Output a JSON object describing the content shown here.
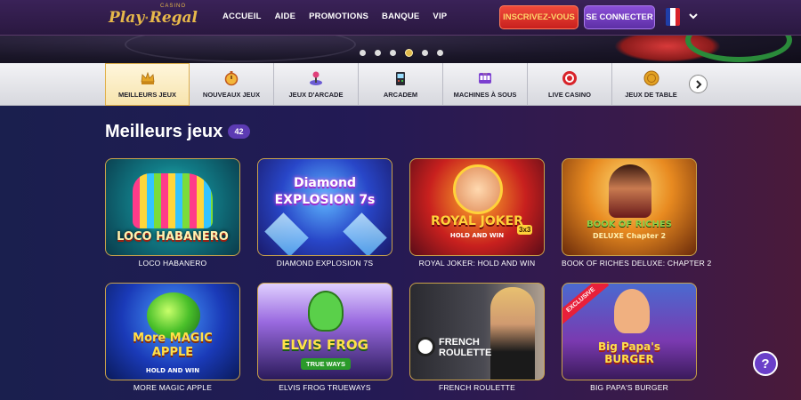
{
  "header": {
    "logo": {
      "play": "Play",
      "regal": "Regal",
      "casino": "CASINO"
    },
    "nav": [
      "ACCUEIL",
      "AIDE",
      "PROMOTIONS",
      "BANQUE",
      "VIP"
    ],
    "signup_label": "INSCRIVEZ-VOUS",
    "login_label": "SE CONNECTER",
    "language_flag": "fr-flag-icon"
  },
  "carousel": {
    "slides": 6,
    "active_index": 3
  },
  "categories": {
    "items": [
      {
        "label": "MEILLEURS JEUX",
        "icon": "crown-icon",
        "active": true
      },
      {
        "label": "NOUVEAUX JEUX",
        "icon": "stopwatch-icon",
        "active": false
      },
      {
        "label": "JEUX D'ARCADE",
        "icon": "joystick-icon",
        "active": false
      },
      {
        "label": "ARCADEM",
        "icon": "arcade-machine-icon",
        "active": false
      },
      {
        "label": "MACHINES À SOUS",
        "icon": "slot-machine-icon",
        "active": false
      },
      {
        "label": "LIVE CASINO",
        "icon": "poker-chip-icon",
        "active": false
      },
      {
        "label": "JEUX DE TABLE",
        "icon": "coin-icon",
        "active": false
      }
    ]
  },
  "section": {
    "title": "Meilleurs jeux",
    "count": "42"
  },
  "games": [
    {
      "name": "LOCO HABANERO",
      "art": "LOCO HABANERO"
    },
    {
      "name": "DIAMOND EXPLOSION 7S",
      "art": "Diamond EXPLOSION 7s"
    },
    {
      "name": "ROYAL JOKER: HOLD AND WIN",
      "art": "ROYAL JOKER"
    },
    {
      "name": "BOOK OF RICHES DELUXE: CHAPTER 2",
      "art": "BOOK OF RICHES"
    },
    {
      "name": "MORE MAGIC APPLE",
      "art": "More MAGIC APPLE"
    },
    {
      "name": "ELVIS FROG TRUEWAYS",
      "art": "ELVIS FROG"
    },
    {
      "name": "FRENCH ROULETTE",
      "art": "FRENCH ROULETTE"
    },
    {
      "name": "BIG PAPA'S BURGER",
      "art": "Big Papa's BURGER"
    }
  ],
  "game_art_sub": {
    "royal_joker": "HOLD AND WIN",
    "royal_joker_badge": "3x3",
    "book_riches": "DELUXE Chapter 2",
    "magic_apple": "HOLD AND WIN",
    "elvis_frog": "TRUE WAYS",
    "big_papa_badge": "EXCLUSIVE"
  },
  "help_label": "?",
  "colors": {
    "accent_gold": "#e1b94a",
    "signup_red": "#d32a22",
    "login_purple": "#6f3fc0",
    "badge_purple": "#5c3bb3"
  }
}
